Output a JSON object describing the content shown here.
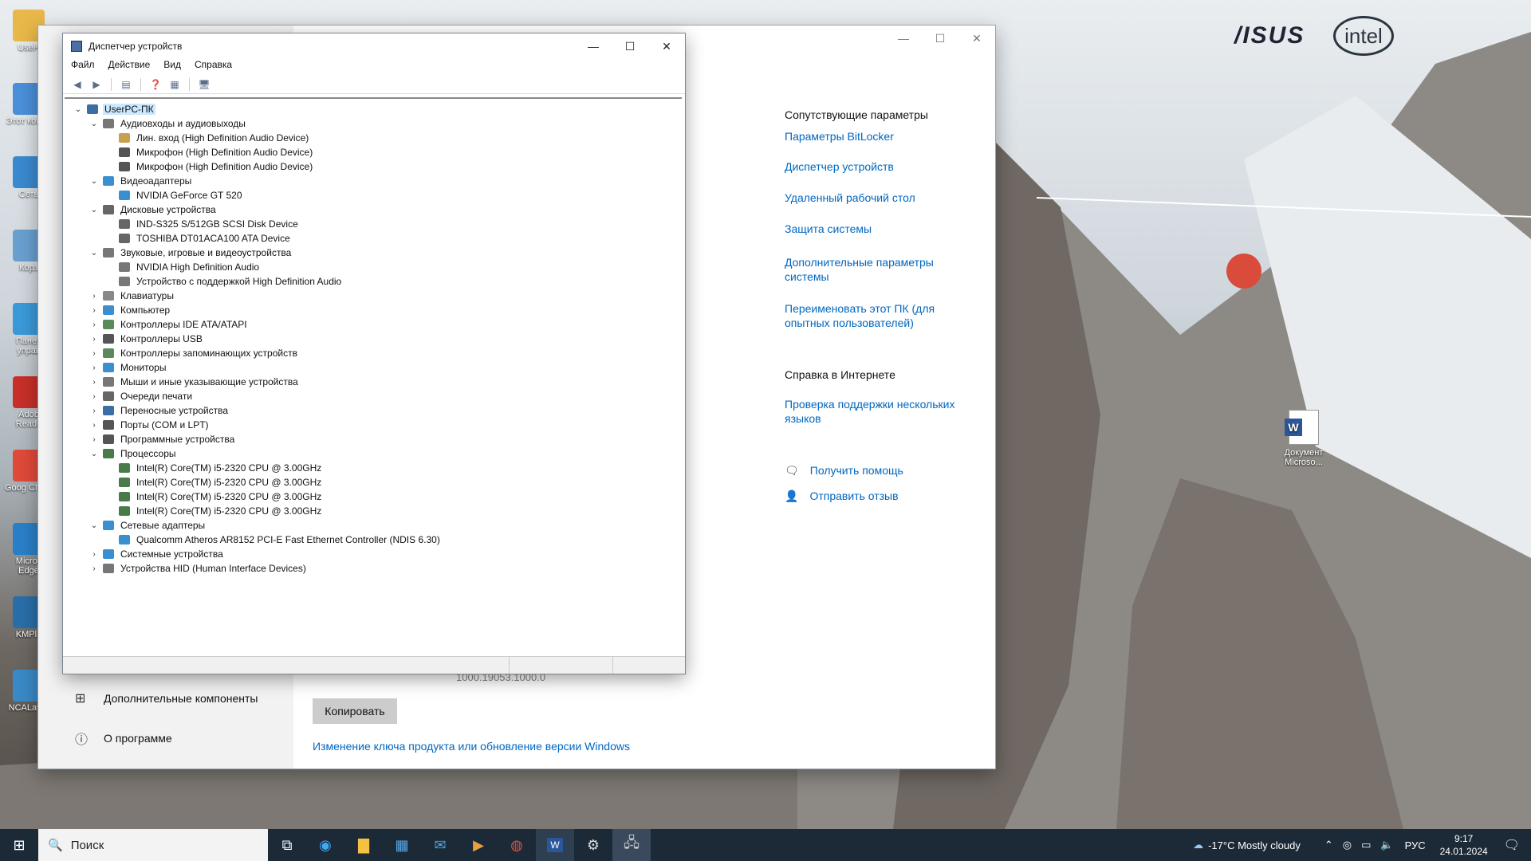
{
  "device_manager": {
    "title": "Диспетчер устройств",
    "menu": [
      "Файл",
      "Действие",
      "Вид",
      "Справка"
    ],
    "tree": [
      {
        "label": "UserPC-ПК",
        "level": 0,
        "expanded": true,
        "icon": "computer-icon",
        "color": "#3a6ea5"
      },
      {
        "label": "Аудиовходы и аудиовыходы",
        "level": 1,
        "expanded": true,
        "icon": "speaker-icon",
        "color": "#777777"
      },
      {
        "label": "Лин. вход (High Definition Audio Device)",
        "level": 2,
        "icon": "line-in-icon",
        "color": "#c9a050"
      },
      {
        "label": "Микрофон (High Definition Audio Device)",
        "level": 2,
        "icon": "microphone-icon",
        "color": "#555555"
      },
      {
        "label": "Микрофон (High Definition Audio Device)",
        "level": 2,
        "icon": "microphone-icon",
        "color": "#555555"
      },
      {
        "label": "Видеоадаптеры",
        "level": 1,
        "expanded": true,
        "icon": "display-adapter-icon",
        "color": "#3a8fd0"
      },
      {
        "label": "NVIDIA GeForce GT 520",
        "level": 2,
        "icon": "display-adapter-icon",
        "color": "#3a8fd0"
      },
      {
        "label": "Дисковые устройства",
        "level": 1,
        "expanded": true,
        "icon": "disk-icon",
        "color": "#666666"
      },
      {
        "label": "IND-S325 S/512GB SCSI Disk Device",
        "level": 2,
        "icon": "disk-icon",
        "color": "#666666"
      },
      {
        "label": "TOSHIBA DT01ACA100 ATA Device",
        "level": 2,
        "icon": "disk-icon",
        "color": "#666666"
      },
      {
        "label": "Звуковые, игровые и видеоустройства",
        "level": 1,
        "expanded": true,
        "icon": "sound-icon",
        "color": "#777777"
      },
      {
        "label": "NVIDIA High Definition Audio",
        "level": 2,
        "icon": "sound-icon",
        "color": "#777777"
      },
      {
        "label": "Устройство с поддержкой High Definition Audio",
        "level": 2,
        "icon": "sound-icon",
        "color": "#777777"
      },
      {
        "label": "Клавиатуры",
        "level": 1,
        "expanded": false,
        "icon": "keyboard-icon",
        "color": "#888888"
      },
      {
        "label": "Компьютер",
        "level": 1,
        "expanded": false,
        "icon": "computer-icon",
        "color": "#3a8fd0"
      },
      {
        "label": "Контроллеры IDE ATA/ATAPI",
        "level": 1,
        "expanded": false,
        "icon": "ide-icon",
        "color": "#5a8a5a"
      },
      {
        "label": "Контроллеры USB",
        "level": 1,
        "expanded": false,
        "icon": "usb-icon",
        "color": "#555555"
      },
      {
        "label": "Контроллеры запоминающих устройств",
        "level": 1,
        "expanded": false,
        "icon": "storage-icon",
        "color": "#5a8a5a"
      },
      {
        "label": "Мониторы",
        "level": 1,
        "expanded": false,
        "icon": "monitor-icon",
        "color": "#3a8fd0"
      },
      {
        "label": "Мыши и иные указывающие устройства",
        "level": 1,
        "expanded": false,
        "icon": "mouse-icon",
        "color": "#777777"
      },
      {
        "label": "Очереди печати",
        "level": 1,
        "expanded": false,
        "icon": "printer-icon",
        "color": "#666666"
      },
      {
        "label": "Переносные устройства",
        "level": 1,
        "expanded": false,
        "icon": "portable-icon",
        "color": "#3a6ea5"
      },
      {
        "label": "Порты (COM и LPT)",
        "level": 1,
        "expanded": false,
        "icon": "port-icon",
        "color": "#555555"
      },
      {
        "label": "Программные устройства",
        "level": 1,
        "expanded": false,
        "icon": "software-device-icon",
        "color": "#555555"
      },
      {
        "label": "Процессоры",
        "level": 1,
        "expanded": true,
        "icon": "processor-icon",
        "color": "#4a7a4a"
      },
      {
        "label": "Intel(R) Core(TM) i5-2320 CPU @ 3.00GHz",
        "level": 2,
        "icon": "processor-icon",
        "color": "#4a7a4a"
      },
      {
        "label": "Intel(R) Core(TM) i5-2320 CPU @ 3.00GHz",
        "level": 2,
        "icon": "processor-icon",
        "color": "#4a7a4a"
      },
      {
        "label": "Intel(R) Core(TM) i5-2320 CPU @ 3.00GHz",
        "level": 2,
        "icon": "processor-icon",
        "color": "#4a7a4a"
      },
      {
        "label": "Intel(R) Core(TM) i5-2320 CPU @ 3.00GHz",
        "level": 2,
        "icon": "processor-icon",
        "color": "#4a7a4a"
      },
      {
        "label": "Сетевые адаптеры",
        "level": 1,
        "expanded": true,
        "icon": "network-adapter-icon",
        "color": "#3a8fd0"
      },
      {
        "label": "Qualcomm Atheros AR8152 PCI-E Fast Ethernet Controller (NDIS 6.30)",
        "level": 2,
        "icon": "network-adapter-icon",
        "color": "#3a8fd0"
      },
      {
        "label": "Системные устройства",
        "level": 1,
        "expanded": false,
        "icon": "system-device-icon",
        "color": "#3a8fd0"
      },
      {
        "label": "Устройства HID (Human Interface Devices)",
        "level": 1,
        "expanded": false,
        "icon": "hid-icon",
        "color": "#777777"
      }
    ]
  },
  "settings": {
    "related_heading": "Сопутствующие параметры",
    "related_links": [
      "Параметры BitLocker",
      "Диспетчер устройств",
      "Удаленный рабочий стол",
      "Защита системы",
      "Дополнительные параметры системы",
      "Переименовать этот ПК (для опытных пользователей)"
    ],
    "help_heading": "Справка в Интернете",
    "help_links": [
      "Проверка поддержки нескольких языков"
    ],
    "get_help": "Получить помощь",
    "feedback": "Отправить отзыв",
    "version_fragment": "1000.19053.1000.0",
    "copy_label": "Копировать",
    "product_key_link": "Изменение ключа продукта или обновление версии Windows",
    "side_items": [
      "Дополнительные компоненты",
      "О программе"
    ]
  },
  "desktop_icons": [
    "UseH",
    "Этот компь",
    "Сеть",
    "Корз",
    "Панел управ",
    "Adob Reade",
    "Goog Chron",
    "Micros Edge",
    "KMPla",
    "NCALayer"
  ],
  "word_doc": "Документ Microso...",
  "taskbar": {
    "search_placeholder": "Поиск",
    "weather": "-17°C  Mostly cloudy",
    "lang": "РУС",
    "time": "9:17",
    "date": "24.01.2024"
  },
  "logos": {
    "asus": "/ISUS",
    "intel": "intel"
  }
}
